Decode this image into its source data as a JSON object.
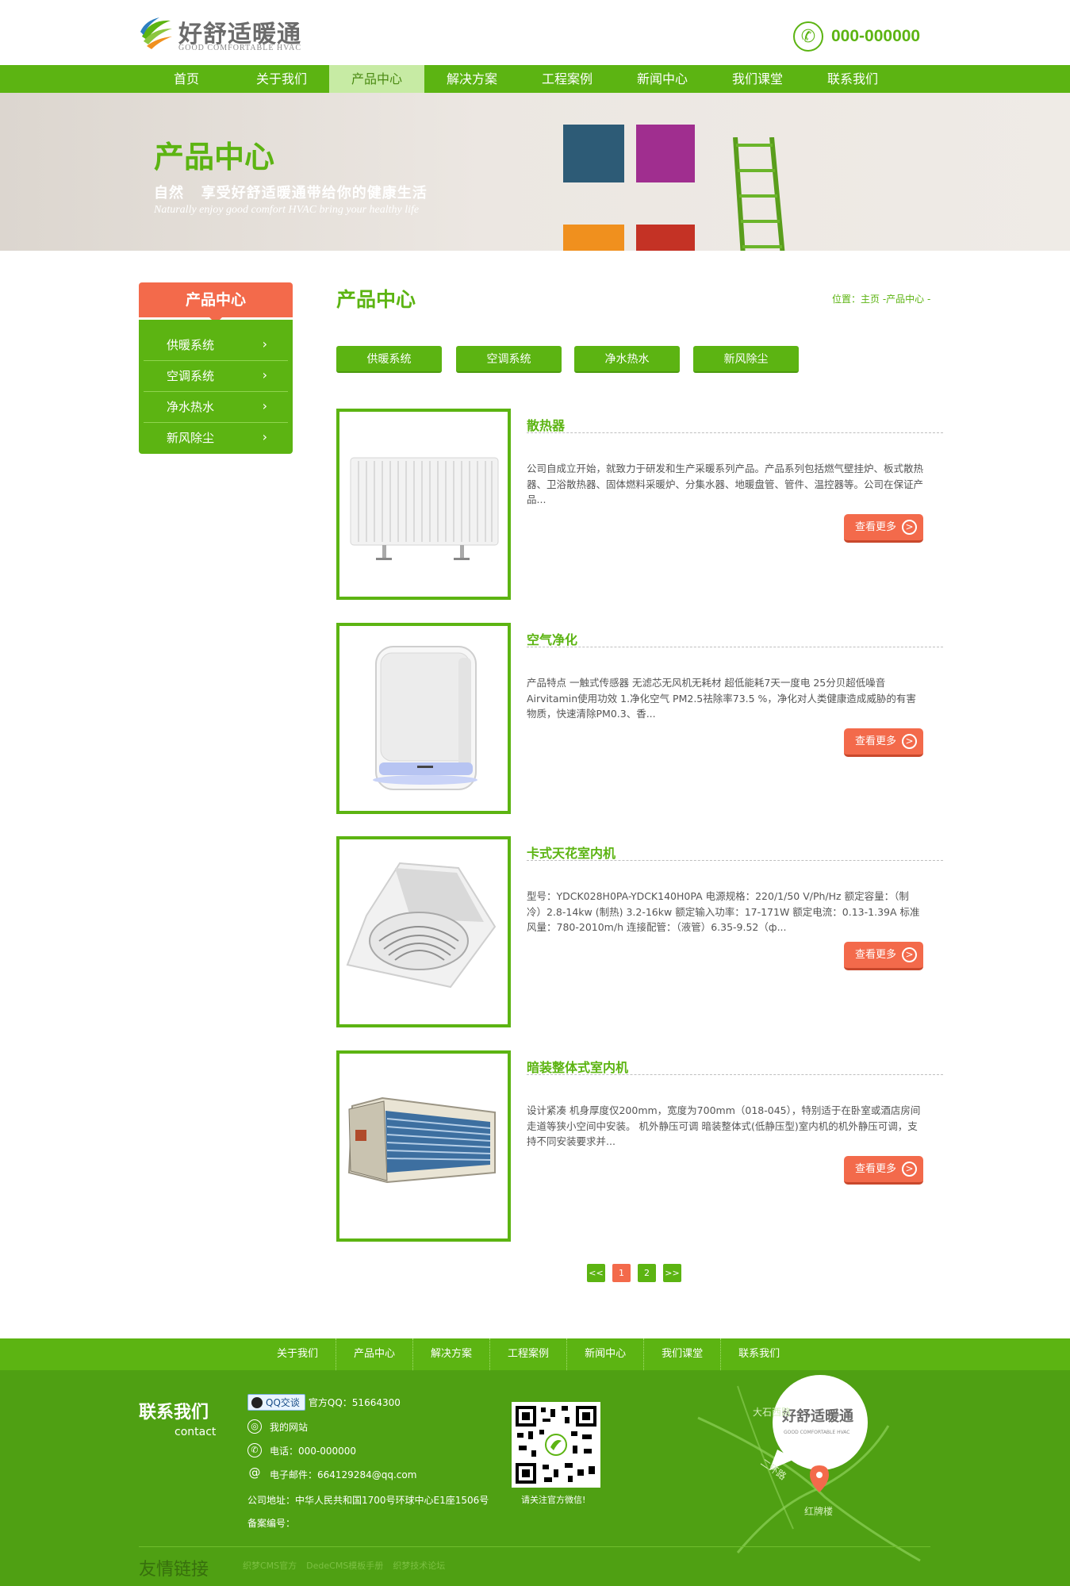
{
  "header": {
    "logo_cn": "好舒适暖通",
    "logo_en": "GOOD COMFORTABLE HVAC",
    "phone": "000-000000"
  },
  "nav": {
    "items": [
      "首页",
      "关于我们",
      "产品中心",
      "解决方案",
      "工程案例",
      "新闻中心",
      "我们课堂",
      "联系我们"
    ],
    "active": "产品中心"
  },
  "banner": {
    "title": "产品中心",
    "subtitle": "自然   享受好舒适暖通带给你的健康生活",
    "subtitle_en": "Naturally enjoy good comfort HVAC bring your healthy life"
  },
  "sidebar": {
    "title": "产品中心",
    "items": [
      {
        "label": "供暖系统",
        "arrow": "›"
      },
      {
        "label": "空调系统",
        "arrow": "›"
      },
      {
        "label": "净水热水",
        "arrow": "›"
      },
      {
        "label": "新风除尘",
        "arrow": "›"
      }
    ]
  },
  "main": {
    "title": "产品中心",
    "breadcrumb": "位置：主页 -产品中心 -",
    "categories": [
      "供暖系统",
      "空调系统",
      "净水热水",
      "新风除尘"
    ],
    "more_label": "查看更多",
    "more_icon": ">",
    "products": [
      {
        "name": "散热器",
        "desc": "公司自成立开始，就致力于研发和生产采暖系列产品。产品系列包括燃气壁挂炉、板式散热器、卫浴散热器、固体燃料采暖炉、分集水器、地暖盘管、管件、温控器等。公司在保证产品..."
      },
      {
        "name": "空气净化",
        "desc": "产品特点 一触式传感器 无滤芯无风机无耗材 超低能耗7天一度电 25分贝超低噪音 Airvitamin使用功效 1.净化空气 PM2.5祛除率73.5 %，净化对人类健康造成威胁的有害物质，快速清除PM0.3、香..."
      },
      {
        "name": "卡式天花室内机",
        "desc": "型号：YDCK028H0PA-YDCK140H0PA 电源规格：220/1/50 V/Ph/Hz 额定容量：（制冷）2.8-14kw (制热) 3.2-16kw 额定输入功率：17-171W 额定电流：0.13-1.39A 标准风量：780-2010m/h 连接配管：（液管）6.35-9.52（ф..."
      },
      {
        "name": "暗装整体式室内机",
        "desc": "设计紧凑 机身厚度仅200mm，宽度为700mm（018-045），特别适于在卧室或酒店房间走道等狭小空间中安装。 机外静压可调 暗装整体式(低静压型)室内机的机外静压可调，支持不同安装要求并..."
      }
    ]
  },
  "pager": {
    "prev": "<<",
    "pages": [
      "1",
      "2"
    ],
    "current": "1",
    "next": ">>"
  },
  "footer": {
    "nav": [
      "关于我们",
      "产品中心",
      "解决方案",
      "工程案例",
      "新闻中心",
      "我们课堂",
      "联系我们"
    ],
    "contact_title": "联系我们",
    "contact_en": "contact",
    "qq_badge": "QQ交谈",
    "qq_text": "官方QQ：51664300",
    "website": "我的网站",
    "phone": "电话：000-000000",
    "email": "电子邮件：664129284@qq.com",
    "address": "公司地址：中华人民共和国1700号环球中心E1座1506号",
    "icp": "备案编号：",
    "qr_caption": "请关注官方微信!",
    "map_logo_cn": "好舒适暖通",
    "map_logo_en": "GOOD COMFORTABLE HVAC",
    "map_road1": "大石西路",
    "map_road2": "二环路",
    "map_road3": "红牌楼",
    "links_title": "友情链接",
    "links": [
      "织梦CMS官方",
      "DedeCMS模板手册",
      "织梦技术论坛"
    ]
  },
  "colors": {
    "green": "#5cb412",
    "orange": "#f36a4b",
    "footer_green": "#4fa013"
  }
}
